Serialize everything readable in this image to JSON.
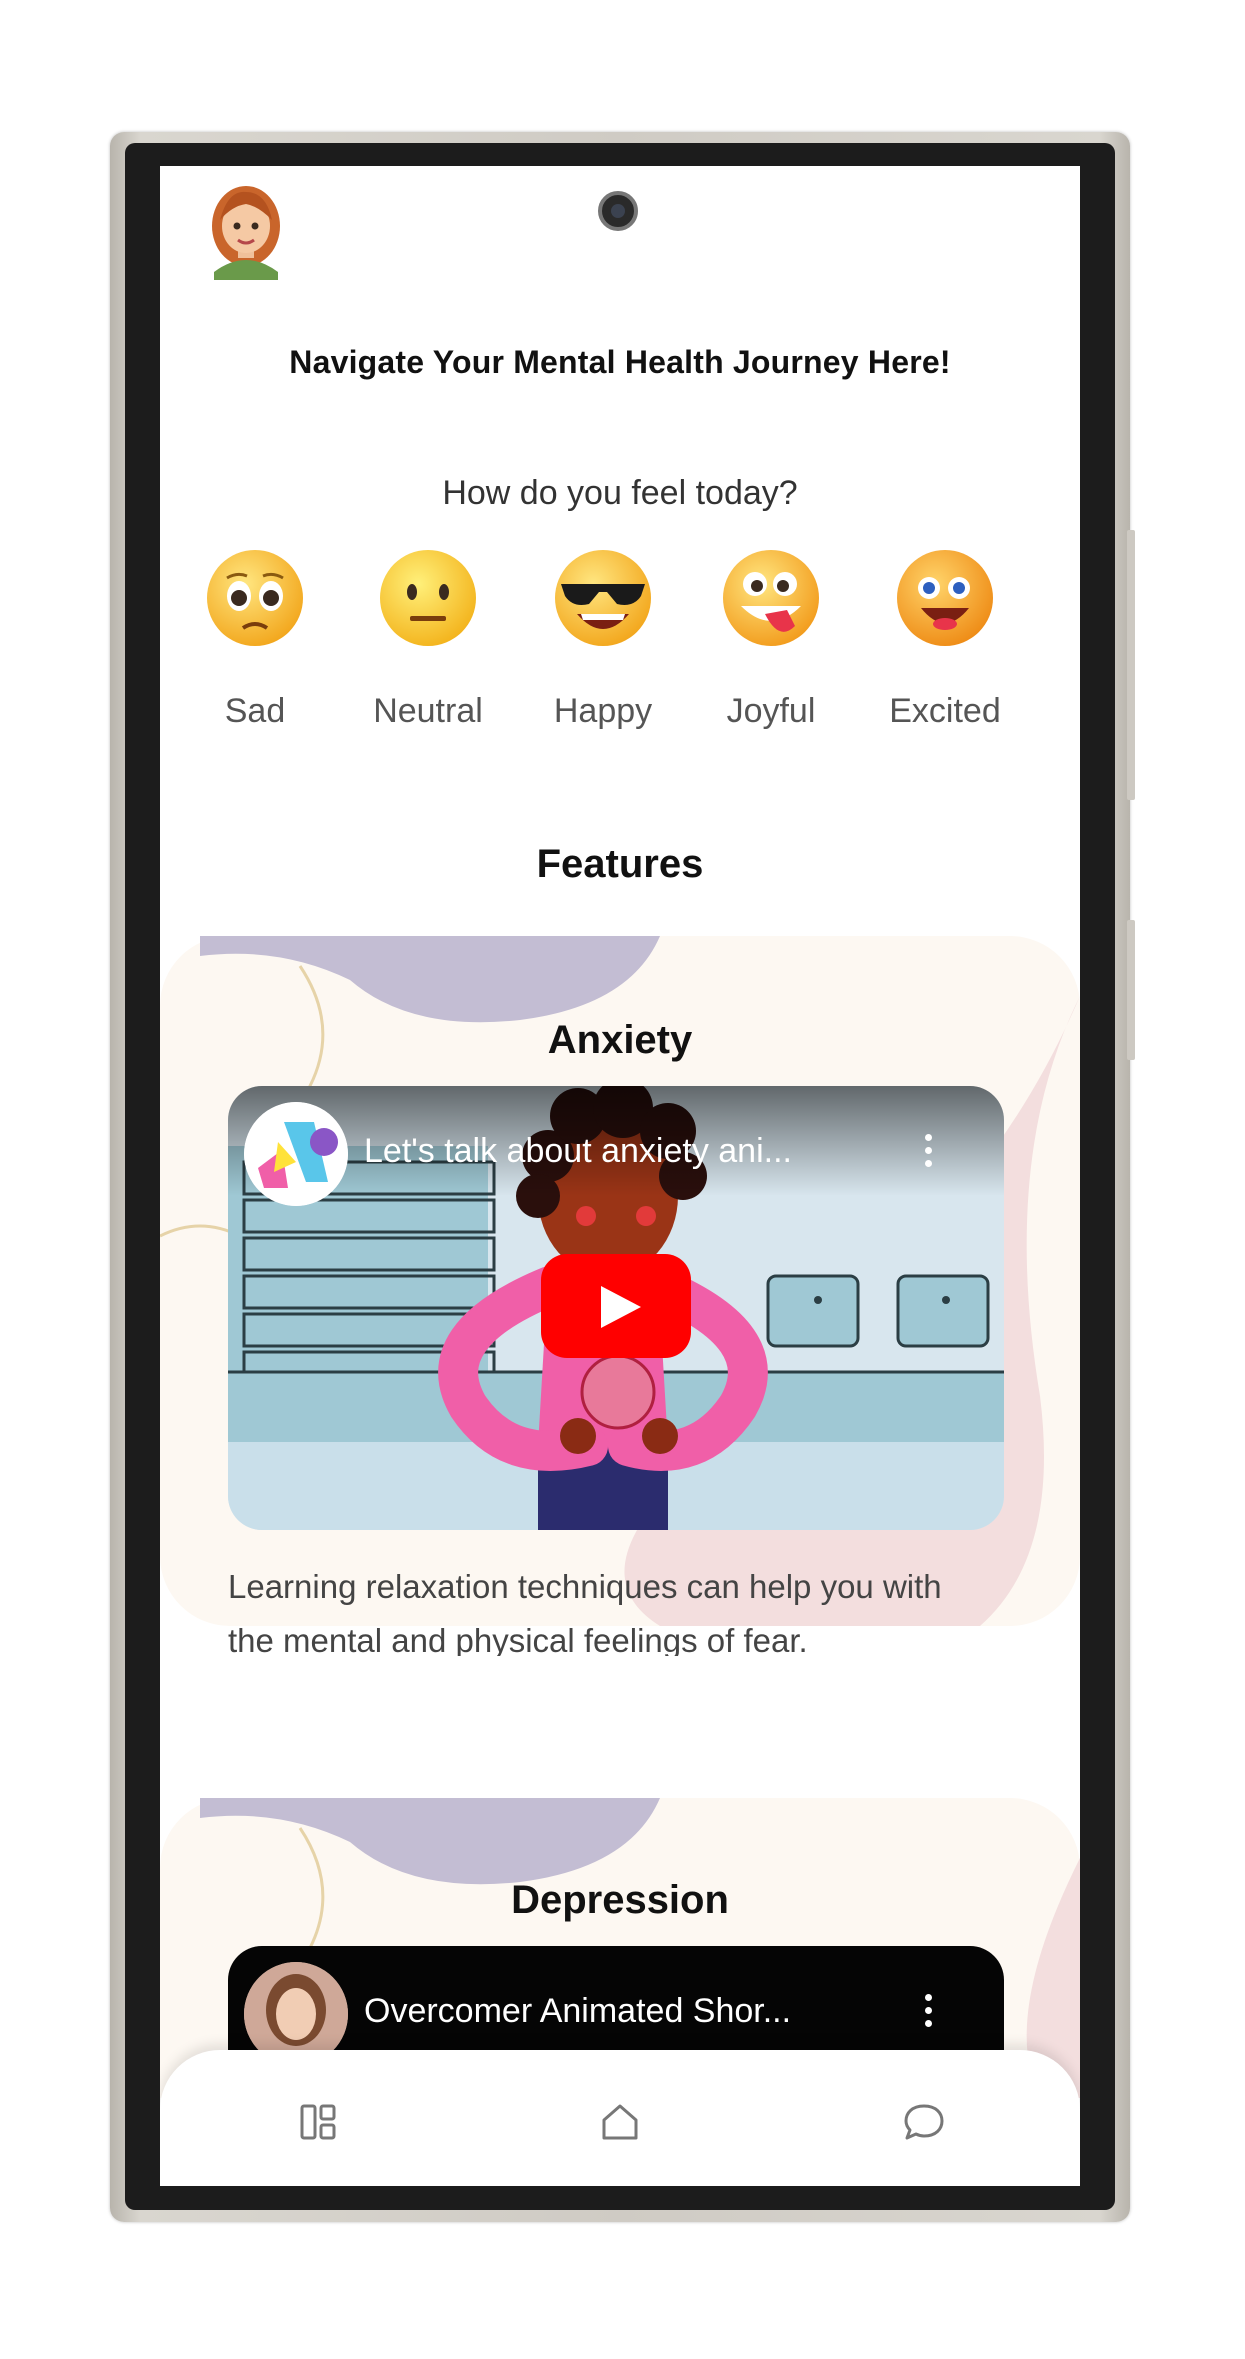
{
  "header": {
    "title": "Navigate Your Mental Health Journey Here!"
  },
  "mood": {
    "prompt": "How do you feel today?",
    "options": [
      {
        "label": "Sad",
        "icon": "sad-emoji-icon"
      },
      {
        "label": "Neutral",
        "icon": "neutral-emoji-icon"
      },
      {
        "label": "Happy",
        "icon": "sunglasses-emoji-icon"
      },
      {
        "label": "Joyful",
        "icon": "tongue-emoji-icon"
      },
      {
        "label": "Excited",
        "icon": "excited-emoji-icon"
      }
    ]
  },
  "features": {
    "title": "Features",
    "cards": [
      {
        "title": "Anxiety",
        "video_title": "Let's talk about anxiety ani...",
        "description": "Learning relaxation techniques can help you with the mental and physical feelings of fear."
      },
      {
        "title": "Depression",
        "video_title": "Overcomer Animated Shor..."
      }
    ]
  },
  "bottom_nav": {
    "items": [
      "dashboard-icon",
      "home-icon",
      "chat-icon"
    ]
  },
  "colors": {
    "youtube_red": "#ff0000",
    "card_cream": "#fdf8f2",
    "blob_lavender": "#c3bdd3",
    "blob_pink": "#f3dede"
  }
}
